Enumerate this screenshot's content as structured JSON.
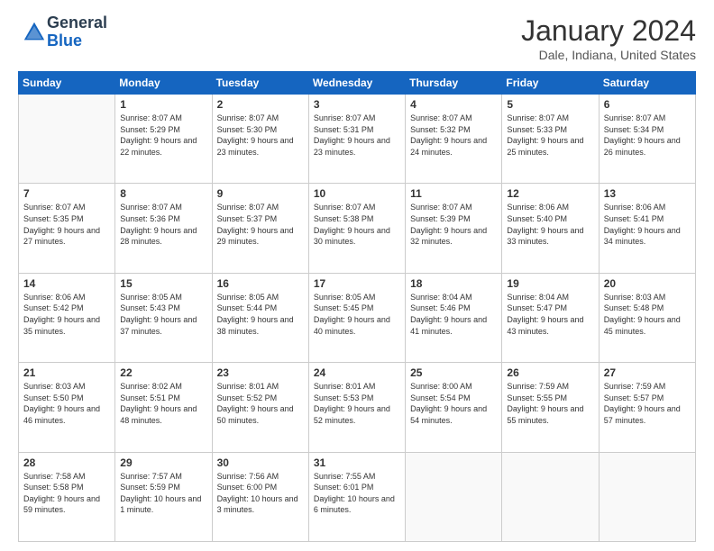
{
  "header": {
    "logo_general": "General",
    "logo_blue": "Blue",
    "month": "January 2024",
    "location": "Dale, Indiana, United States"
  },
  "weekdays": [
    "Sunday",
    "Monday",
    "Tuesday",
    "Wednesday",
    "Thursday",
    "Friday",
    "Saturday"
  ],
  "weeks": [
    [
      {
        "day": "",
        "sunrise": "",
        "sunset": "",
        "daylight": ""
      },
      {
        "day": "1",
        "sunrise": "Sunrise: 8:07 AM",
        "sunset": "Sunset: 5:29 PM",
        "daylight": "Daylight: 9 hours and 22 minutes."
      },
      {
        "day": "2",
        "sunrise": "Sunrise: 8:07 AM",
        "sunset": "Sunset: 5:30 PM",
        "daylight": "Daylight: 9 hours and 23 minutes."
      },
      {
        "day": "3",
        "sunrise": "Sunrise: 8:07 AM",
        "sunset": "Sunset: 5:31 PM",
        "daylight": "Daylight: 9 hours and 23 minutes."
      },
      {
        "day": "4",
        "sunrise": "Sunrise: 8:07 AM",
        "sunset": "Sunset: 5:32 PM",
        "daylight": "Daylight: 9 hours and 24 minutes."
      },
      {
        "day": "5",
        "sunrise": "Sunrise: 8:07 AM",
        "sunset": "Sunset: 5:33 PM",
        "daylight": "Daylight: 9 hours and 25 minutes."
      },
      {
        "day": "6",
        "sunrise": "Sunrise: 8:07 AM",
        "sunset": "Sunset: 5:34 PM",
        "daylight": "Daylight: 9 hours and 26 minutes."
      }
    ],
    [
      {
        "day": "7",
        "sunrise": "Sunrise: 8:07 AM",
        "sunset": "Sunset: 5:35 PM",
        "daylight": "Daylight: 9 hours and 27 minutes."
      },
      {
        "day": "8",
        "sunrise": "Sunrise: 8:07 AM",
        "sunset": "Sunset: 5:36 PM",
        "daylight": "Daylight: 9 hours and 28 minutes."
      },
      {
        "day": "9",
        "sunrise": "Sunrise: 8:07 AM",
        "sunset": "Sunset: 5:37 PM",
        "daylight": "Daylight: 9 hours and 29 minutes."
      },
      {
        "day": "10",
        "sunrise": "Sunrise: 8:07 AM",
        "sunset": "Sunset: 5:38 PM",
        "daylight": "Daylight: 9 hours and 30 minutes."
      },
      {
        "day": "11",
        "sunrise": "Sunrise: 8:07 AM",
        "sunset": "Sunset: 5:39 PM",
        "daylight": "Daylight: 9 hours and 32 minutes."
      },
      {
        "day": "12",
        "sunrise": "Sunrise: 8:06 AM",
        "sunset": "Sunset: 5:40 PM",
        "daylight": "Daylight: 9 hours and 33 minutes."
      },
      {
        "day": "13",
        "sunrise": "Sunrise: 8:06 AM",
        "sunset": "Sunset: 5:41 PM",
        "daylight": "Daylight: 9 hours and 34 minutes."
      }
    ],
    [
      {
        "day": "14",
        "sunrise": "Sunrise: 8:06 AM",
        "sunset": "Sunset: 5:42 PM",
        "daylight": "Daylight: 9 hours and 35 minutes."
      },
      {
        "day": "15",
        "sunrise": "Sunrise: 8:05 AM",
        "sunset": "Sunset: 5:43 PM",
        "daylight": "Daylight: 9 hours and 37 minutes."
      },
      {
        "day": "16",
        "sunrise": "Sunrise: 8:05 AM",
        "sunset": "Sunset: 5:44 PM",
        "daylight": "Daylight: 9 hours and 38 minutes."
      },
      {
        "day": "17",
        "sunrise": "Sunrise: 8:05 AM",
        "sunset": "Sunset: 5:45 PM",
        "daylight": "Daylight: 9 hours and 40 minutes."
      },
      {
        "day": "18",
        "sunrise": "Sunrise: 8:04 AM",
        "sunset": "Sunset: 5:46 PM",
        "daylight": "Daylight: 9 hours and 41 minutes."
      },
      {
        "day": "19",
        "sunrise": "Sunrise: 8:04 AM",
        "sunset": "Sunset: 5:47 PM",
        "daylight": "Daylight: 9 hours and 43 minutes."
      },
      {
        "day": "20",
        "sunrise": "Sunrise: 8:03 AM",
        "sunset": "Sunset: 5:48 PM",
        "daylight": "Daylight: 9 hours and 45 minutes."
      }
    ],
    [
      {
        "day": "21",
        "sunrise": "Sunrise: 8:03 AM",
        "sunset": "Sunset: 5:50 PM",
        "daylight": "Daylight: 9 hours and 46 minutes."
      },
      {
        "day": "22",
        "sunrise": "Sunrise: 8:02 AM",
        "sunset": "Sunset: 5:51 PM",
        "daylight": "Daylight: 9 hours and 48 minutes."
      },
      {
        "day": "23",
        "sunrise": "Sunrise: 8:01 AM",
        "sunset": "Sunset: 5:52 PM",
        "daylight": "Daylight: 9 hours and 50 minutes."
      },
      {
        "day": "24",
        "sunrise": "Sunrise: 8:01 AM",
        "sunset": "Sunset: 5:53 PM",
        "daylight": "Daylight: 9 hours and 52 minutes."
      },
      {
        "day": "25",
        "sunrise": "Sunrise: 8:00 AM",
        "sunset": "Sunset: 5:54 PM",
        "daylight": "Daylight: 9 hours and 54 minutes."
      },
      {
        "day": "26",
        "sunrise": "Sunrise: 7:59 AM",
        "sunset": "Sunset: 5:55 PM",
        "daylight": "Daylight: 9 hours and 55 minutes."
      },
      {
        "day": "27",
        "sunrise": "Sunrise: 7:59 AM",
        "sunset": "Sunset: 5:57 PM",
        "daylight": "Daylight: 9 hours and 57 minutes."
      }
    ],
    [
      {
        "day": "28",
        "sunrise": "Sunrise: 7:58 AM",
        "sunset": "Sunset: 5:58 PM",
        "daylight": "Daylight: 9 hours and 59 minutes."
      },
      {
        "day": "29",
        "sunrise": "Sunrise: 7:57 AM",
        "sunset": "Sunset: 5:59 PM",
        "daylight": "Daylight: 10 hours and 1 minute."
      },
      {
        "day": "30",
        "sunrise": "Sunrise: 7:56 AM",
        "sunset": "Sunset: 6:00 PM",
        "daylight": "Daylight: 10 hours and 3 minutes."
      },
      {
        "day": "31",
        "sunrise": "Sunrise: 7:55 AM",
        "sunset": "Sunset: 6:01 PM",
        "daylight": "Daylight: 10 hours and 6 minutes."
      },
      {
        "day": "",
        "sunrise": "",
        "sunset": "",
        "daylight": ""
      },
      {
        "day": "",
        "sunrise": "",
        "sunset": "",
        "daylight": ""
      },
      {
        "day": "",
        "sunrise": "",
        "sunset": "",
        "daylight": ""
      }
    ]
  ]
}
